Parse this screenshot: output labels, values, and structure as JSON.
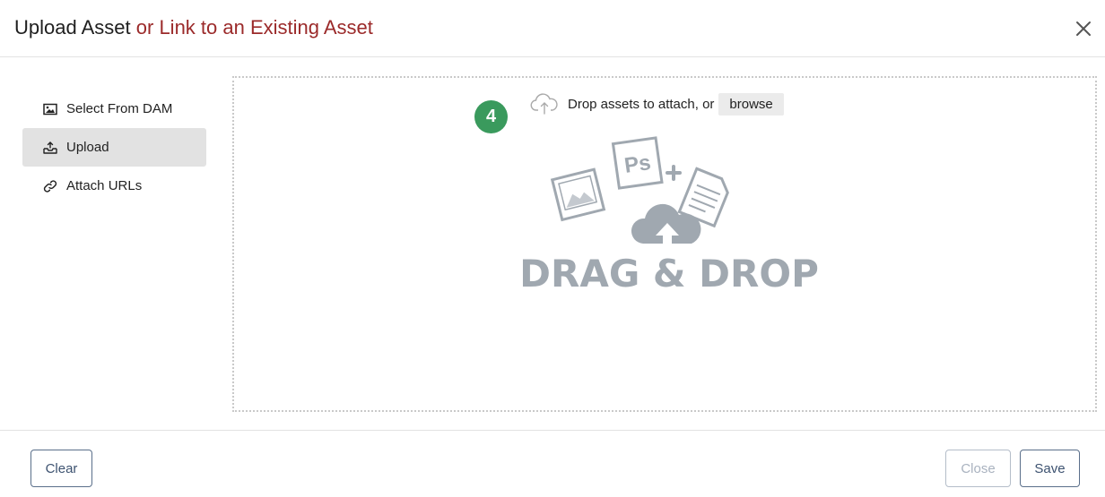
{
  "dialog": {
    "title_main": "Upload Asset",
    "title_link": "or Link to an Existing Asset"
  },
  "sidebar": {
    "items": [
      {
        "label": "Select From DAM",
        "icon": "image-icon",
        "active": false
      },
      {
        "label": "Upload",
        "icon": "upload-tray-icon",
        "active": true
      },
      {
        "label": "Attach URLs",
        "icon": "link-icon",
        "active": false
      }
    ]
  },
  "dropzone": {
    "prompt": "Drop assets to attach, or",
    "browse_label": "browse",
    "step_badge": "4",
    "illustration_text": "DRAG & DROP",
    "illustration_ps": "Ps"
  },
  "footer": {
    "clear_label": "Clear",
    "close_label": "Close",
    "save_label": "Save"
  },
  "colors": {
    "title_link": "#9b2a2a",
    "badge": "#3a9a5d",
    "button_border": "#5a6f8a",
    "illustration": "#a0a8b0"
  }
}
